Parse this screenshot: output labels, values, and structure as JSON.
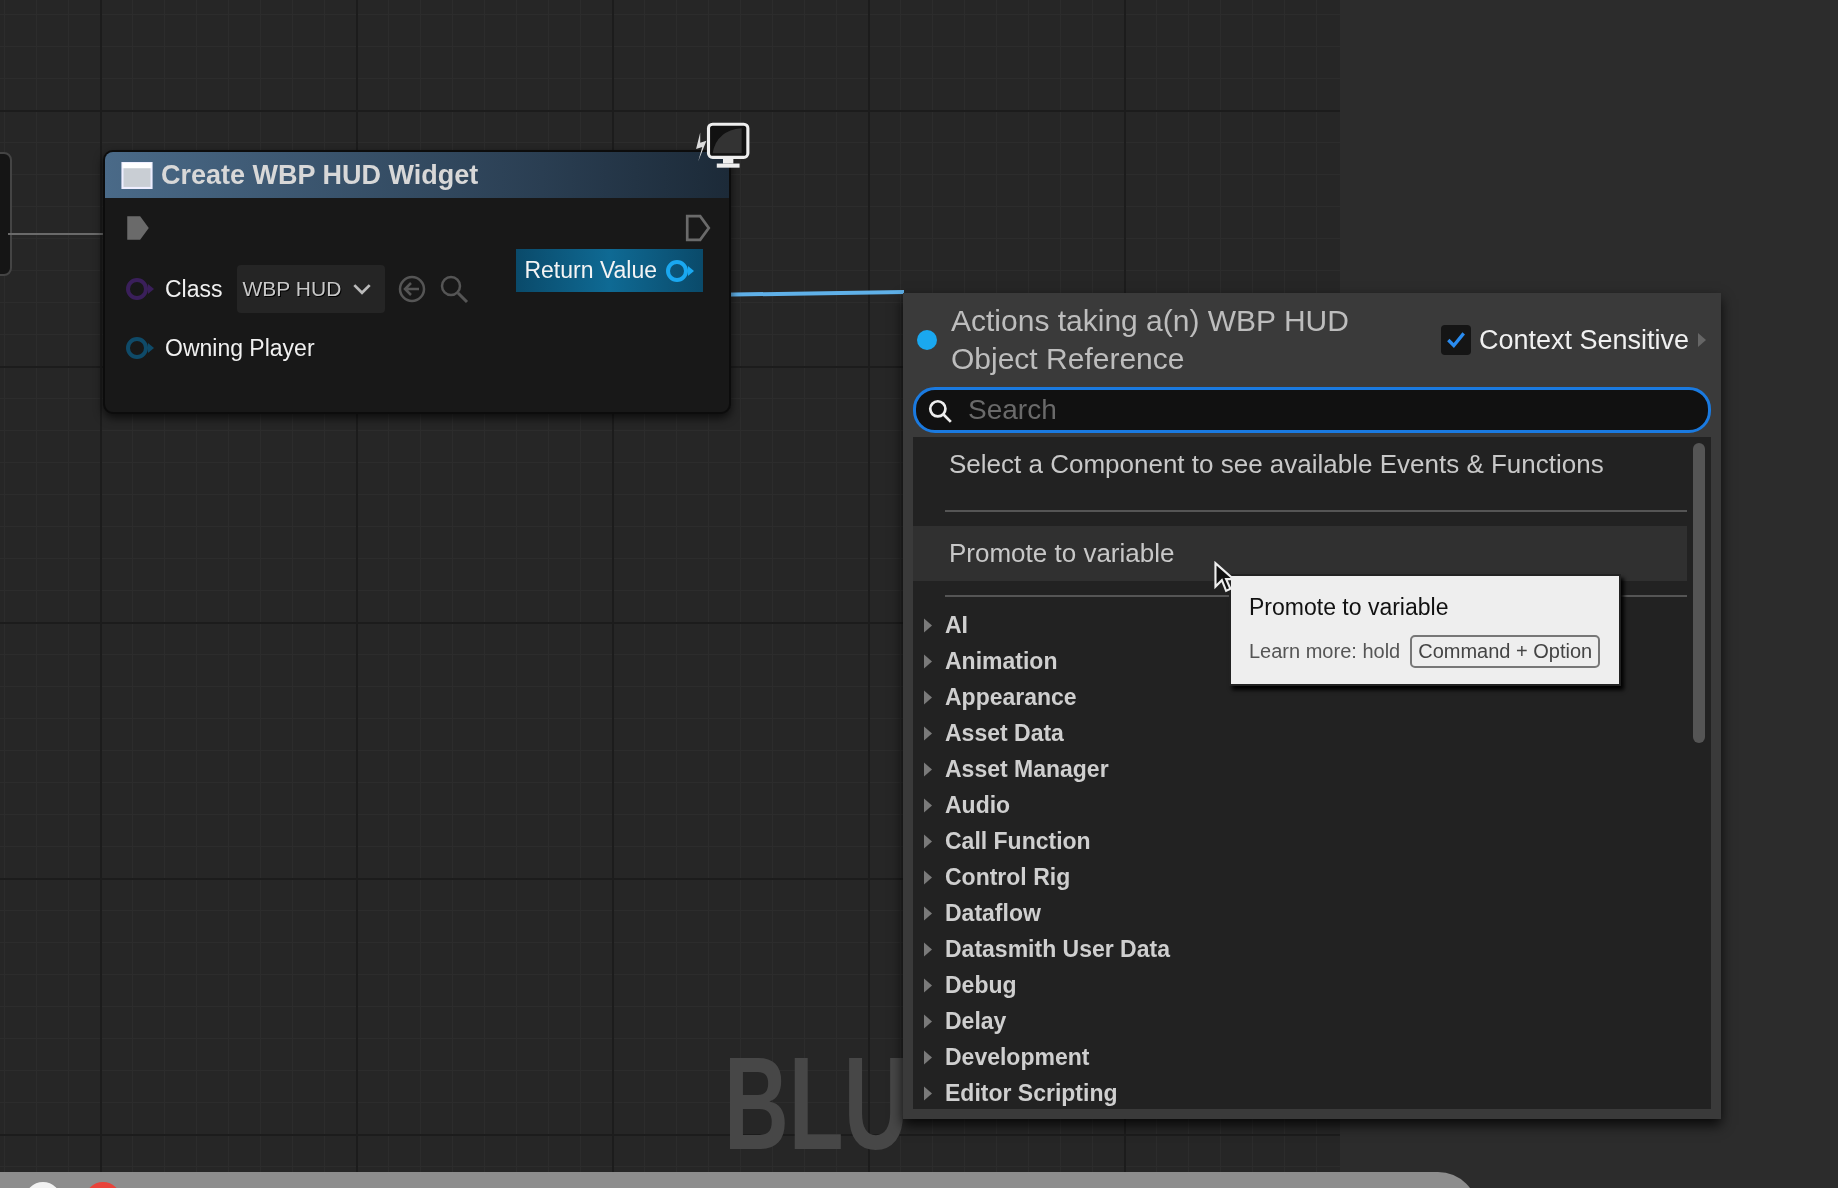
{
  "node": {
    "title": "Create WBP HUD Widget",
    "pins": [
      {
        "kind": "class",
        "label": "Class",
        "value": "WBP HUD"
      },
      {
        "kind": "object",
        "label": "Owning Player"
      }
    ],
    "output": {
      "label": "Return Value"
    }
  },
  "menu": {
    "title": "Actions taking a(n) WBP HUD Object Reference",
    "context_sensitive": {
      "label": "Context Sensitive",
      "checked": true
    },
    "search": {
      "placeholder": "Search"
    },
    "hint": "Select a Component to see available Events & Functions",
    "actions": [
      {
        "label": "Promote to variable",
        "selected": true
      }
    ],
    "categories": [
      "AI",
      "Animation",
      "Appearance",
      "Asset Data",
      "Asset Manager",
      "Audio",
      "Call Function",
      "Control Rig",
      "Dataflow",
      "Datasmith User Data",
      "Debug",
      "Delay",
      "Development",
      "Editor Scripting"
    ],
    "tooltip": {
      "title": "Promote to variable",
      "learn_more": "Learn more: hold",
      "shortcut": "Command + Option"
    }
  },
  "watermark": "BLU"
}
